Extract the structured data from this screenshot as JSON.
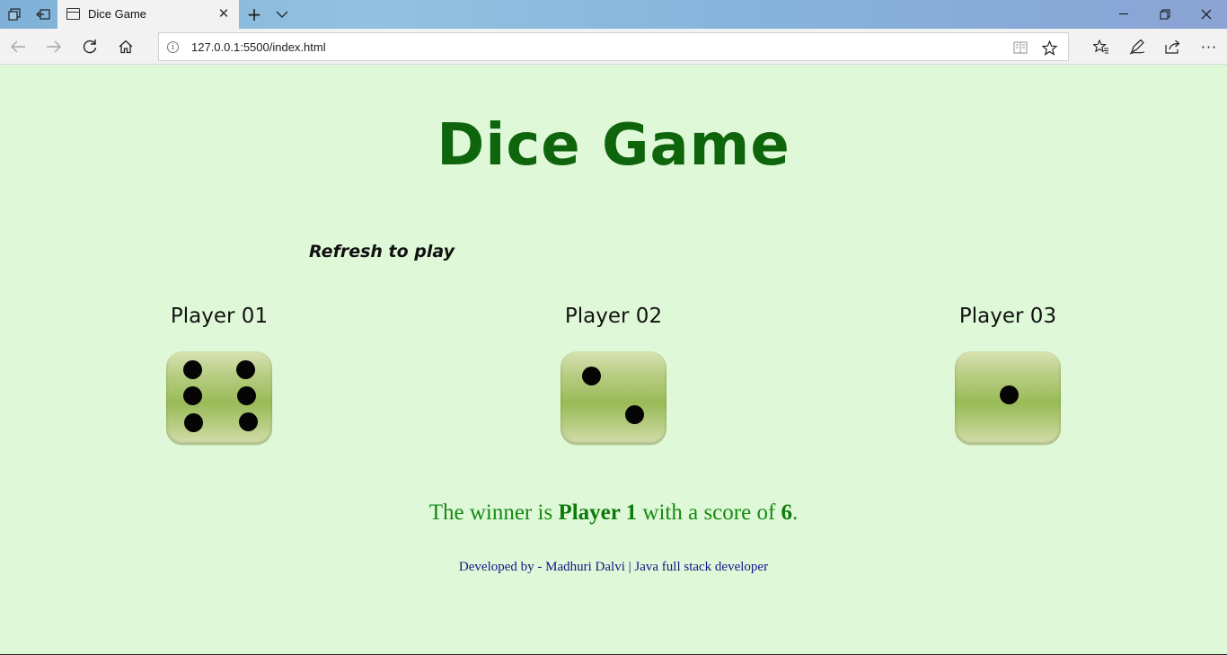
{
  "browser": {
    "tab_title": "Dice Game",
    "url": "127.0.0.1:5500/index.html"
  },
  "page": {
    "heading": "Dice Game",
    "refresh_text": "Refresh to play",
    "players": [
      {
        "label": "Player 01",
        "die_value": 6
      },
      {
        "label": "Player 02",
        "die_value": 2
      },
      {
        "label": "Player 03",
        "die_value": 1
      }
    ],
    "result": {
      "prefix": "The winner is ",
      "winner": "Player 1",
      "middle": " with a score of ",
      "score": "6",
      "suffix": "."
    },
    "footer": "Developed by - Madhuri Dalvi | Java full stack developer"
  },
  "icons": {
    "dice_color": "#99bb57",
    "heading_color": "#0f650c",
    "result_color": "#168a13",
    "footer_color": "#14148a"
  }
}
